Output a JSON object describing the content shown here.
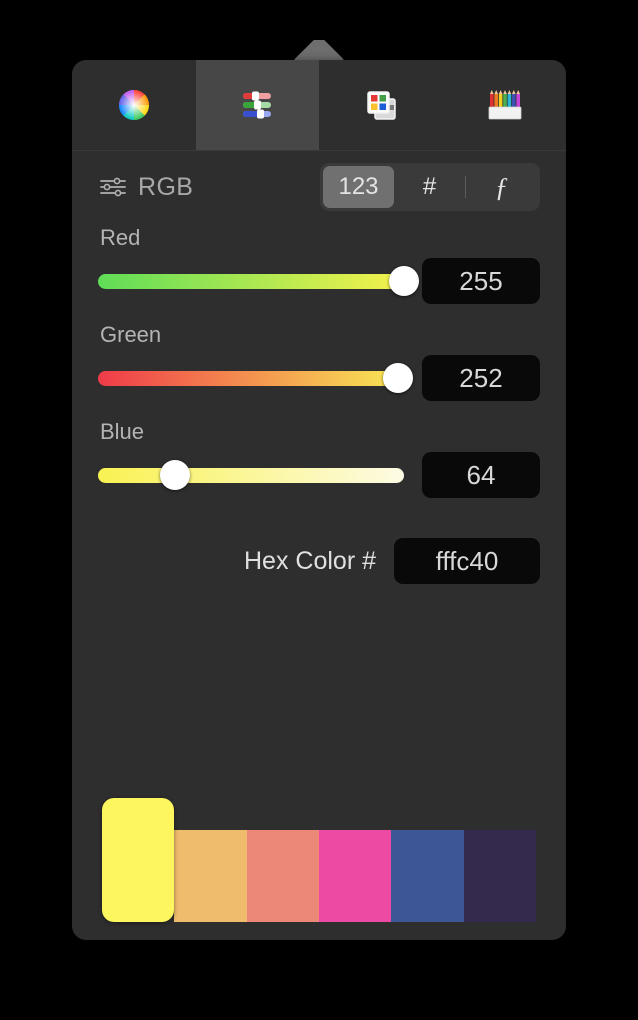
{
  "panel": {
    "background": "#2e2e2e",
    "caret_color": "#6e6e6e"
  },
  "tabs": [
    {
      "name": "color-wheel",
      "icon": "color-wheel-icon",
      "selected": false
    },
    {
      "name": "color-sliders",
      "icon": "rgb-sliders-icon",
      "selected": true
    },
    {
      "name": "color-palettes",
      "icon": "color-palettes-icon",
      "selected": false
    },
    {
      "name": "image-palettes",
      "icon": "color-pencils-icon",
      "selected": false
    }
  ],
  "mode": {
    "icon": "sliders-icon",
    "label": "RGB",
    "formats": [
      {
        "label": "123",
        "name": "decimal",
        "selected": true
      },
      {
        "label": "#",
        "name": "hex",
        "selected": false
      },
      {
        "label": "ƒ",
        "name": "percent-function",
        "selected": false
      }
    ]
  },
  "channels": [
    {
      "label": "Red",
      "value": "255",
      "percent": 100,
      "gradient_from": "#5fdd57",
      "gradient_to": "#f6f24c"
    },
    {
      "label": "Green",
      "value": "252",
      "percent": 98,
      "gradient_from": "#ef3b49",
      "gradient_to": "#f8ea55"
    },
    {
      "label": "Blue",
      "value": "64",
      "percent": 25,
      "gradient_from": "#f9f252",
      "gradient_to": "#fdfbe4"
    }
  ],
  "hex": {
    "label": "Hex Color #",
    "value": "fffc40"
  },
  "swatches": [
    {
      "color": "#fdf65e",
      "selected": true
    },
    {
      "color": "#efbb6c",
      "selected": false
    },
    {
      "color": "#ec8878",
      "selected": false
    },
    {
      "color": "#ec4aa3",
      "selected": false
    },
    {
      "color": "#3d5695",
      "selected": false
    },
    {
      "color": "#332a4e",
      "selected": false
    }
  ]
}
